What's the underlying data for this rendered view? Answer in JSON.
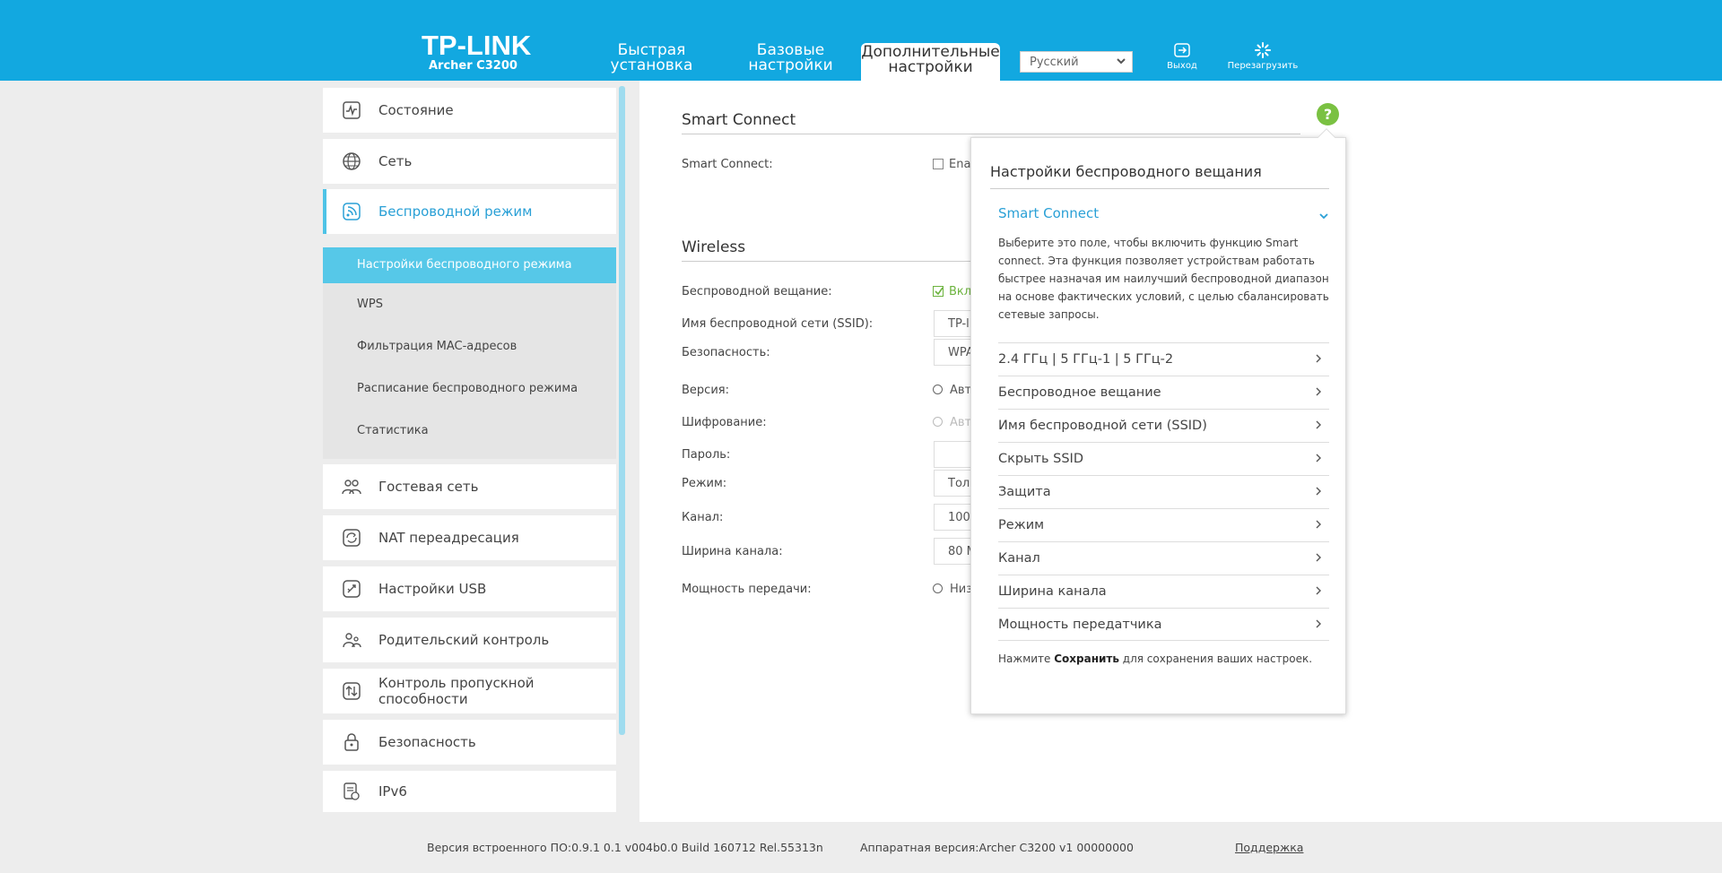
{
  "header": {
    "logo": "TP-LINK",
    "model": "Archer C3200",
    "tabs": [
      {
        "line1": "Быстрая",
        "line2": "установка"
      },
      {
        "line1": "Базовые",
        "line2": "настройки"
      },
      {
        "line1": "Дополнительные",
        "line2": "настройки"
      }
    ],
    "language": "Русский",
    "logout_label": "Выход",
    "reboot_label": "Перезагрузить"
  },
  "sidebar": {
    "items": [
      {
        "label": "Состояние",
        "icon": "status-icon"
      },
      {
        "label": "Сеть",
        "icon": "globe-icon"
      },
      {
        "label": "Беспроводной режим",
        "icon": "wireless-icon"
      },
      {
        "label": "Гостевая сеть",
        "icon": "guest-icon"
      },
      {
        "label": "NAT переадресация",
        "icon": "nat-icon"
      },
      {
        "label": "Настройки USB",
        "icon": "usb-icon"
      },
      {
        "label": "Родительский контроль",
        "icon": "parental-icon"
      },
      {
        "label": "Контроль пропускной способности",
        "icon": "bandwidth-icon"
      },
      {
        "label": "Безопасность",
        "icon": "lock-icon"
      },
      {
        "label": "IPv6",
        "icon": "ipv6-icon"
      }
    ],
    "submenu": [
      "Настройки беспроводного режима",
      "WPS",
      "Фильтрация MAC-адресов",
      "Расписание беспроводного режима",
      "Статистика"
    ]
  },
  "main": {
    "smart_connect_title": "Smart Connect",
    "smart_connect_label": "Smart Connect:",
    "smart_connect_value": "Ena",
    "wireless_title": "Wireless",
    "rows": {
      "broadcast_label": "Беспроводной вещание:",
      "broadcast_value": "Вкл",
      "ssid_label": "Имя беспроводной сети (SSID):",
      "ssid_value": "TP-l",
      "security_label": "Безопасность:",
      "security_value": "WPA",
      "version_label": "Версия:",
      "version_value": "Авт",
      "encryption_label": "Шифрование:",
      "encryption_value": "Авт",
      "password_label": "Пароль:",
      "mode_label": "Режим:",
      "mode_value": "Тол",
      "channel_label": "Канал:",
      "channel_value": "100",
      "width_label": "Ширина канала:",
      "width_value": "80 M",
      "power_label": "Мощность передачи:",
      "power_value": "Низ"
    }
  },
  "help": {
    "button": "?",
    "title": "Настройки беспроводного вещания",
    "expanded_item": "Smart Connect",
    "description": "Выберите это поле, чтобы включить функцию Smart connect. Эта функция позволяет устройствам работать быстрее назначая им наилучший беспроводной диапазон на основе фактических условий, с целью сбалансировать сетевые запросы.",
    "items": [
      "2.4 ГГц | 5 ГГц-1 | 5 ГГц-2",
      "Беспроводное вещание",
      "Имя беспроводной сети (SSID)",
      "Скрыть SSID",
      "Защита",
      "Режим",
      "Канал",
      "Ширина канала",
      "Мощность передатчика"
    ],
    "note_prefix": "Нажмите ",
    "note_bold": "Сохранить",
    "note_suffix": " для сохранения ваших настроек."
  },
  "footer": {
    "firmware": "Версия встроенного ПО:0.9.1 0.1 v004b0.0 Build 160712 Rel.55313n",
    "hardware": "Аппаратная версия:Archer C3200 v1 00000000",
    "support": "Поддержка"
  },
  "colors": {
    "header": "#12a8e0",
    "accent": "#2aa0d6",
    "submenu_active": "#56c8e8",
    "help_green": "#7ac142"
  }
}
